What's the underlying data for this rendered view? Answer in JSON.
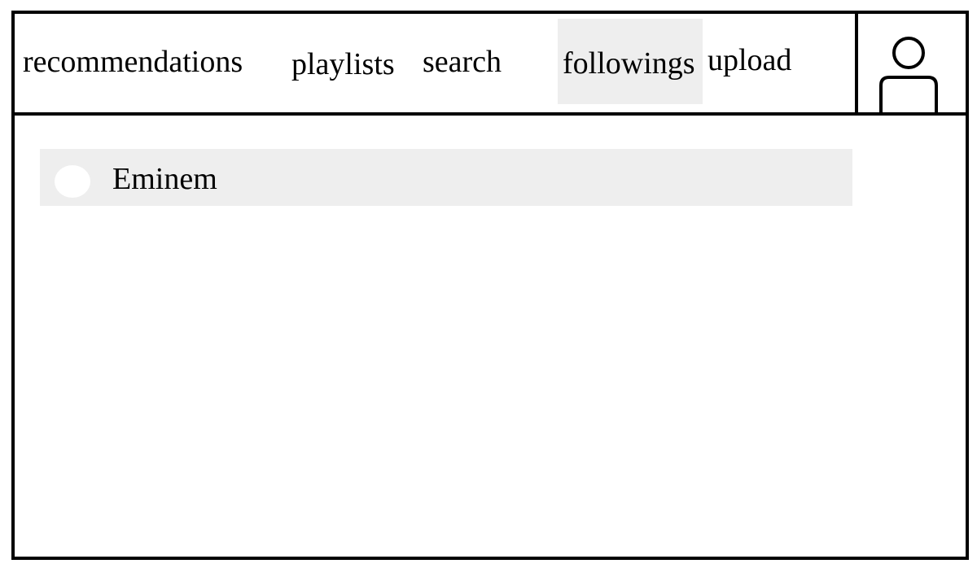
{
  "nav": {
    "items": [
      {
        "label": "recommendations"
      },
      {
        "label": "playlists"
      },
      {
        "label": "search"
      },
      {
        "label": "followings",
        "active": true
      },
      {
        "label": "upload"
      }
    ],
    "active_bg_color": "#eeeeee"
  },
  "profile": {
    "icon": "user-icon"
  },
  "followings": {
    "items": [
      {
        "name": "Eminem",
        "avatar_icon": "avatar-placeholder-icon"
      }
    ],
    "item_bg_color": "#eeeeee"
  }
}
